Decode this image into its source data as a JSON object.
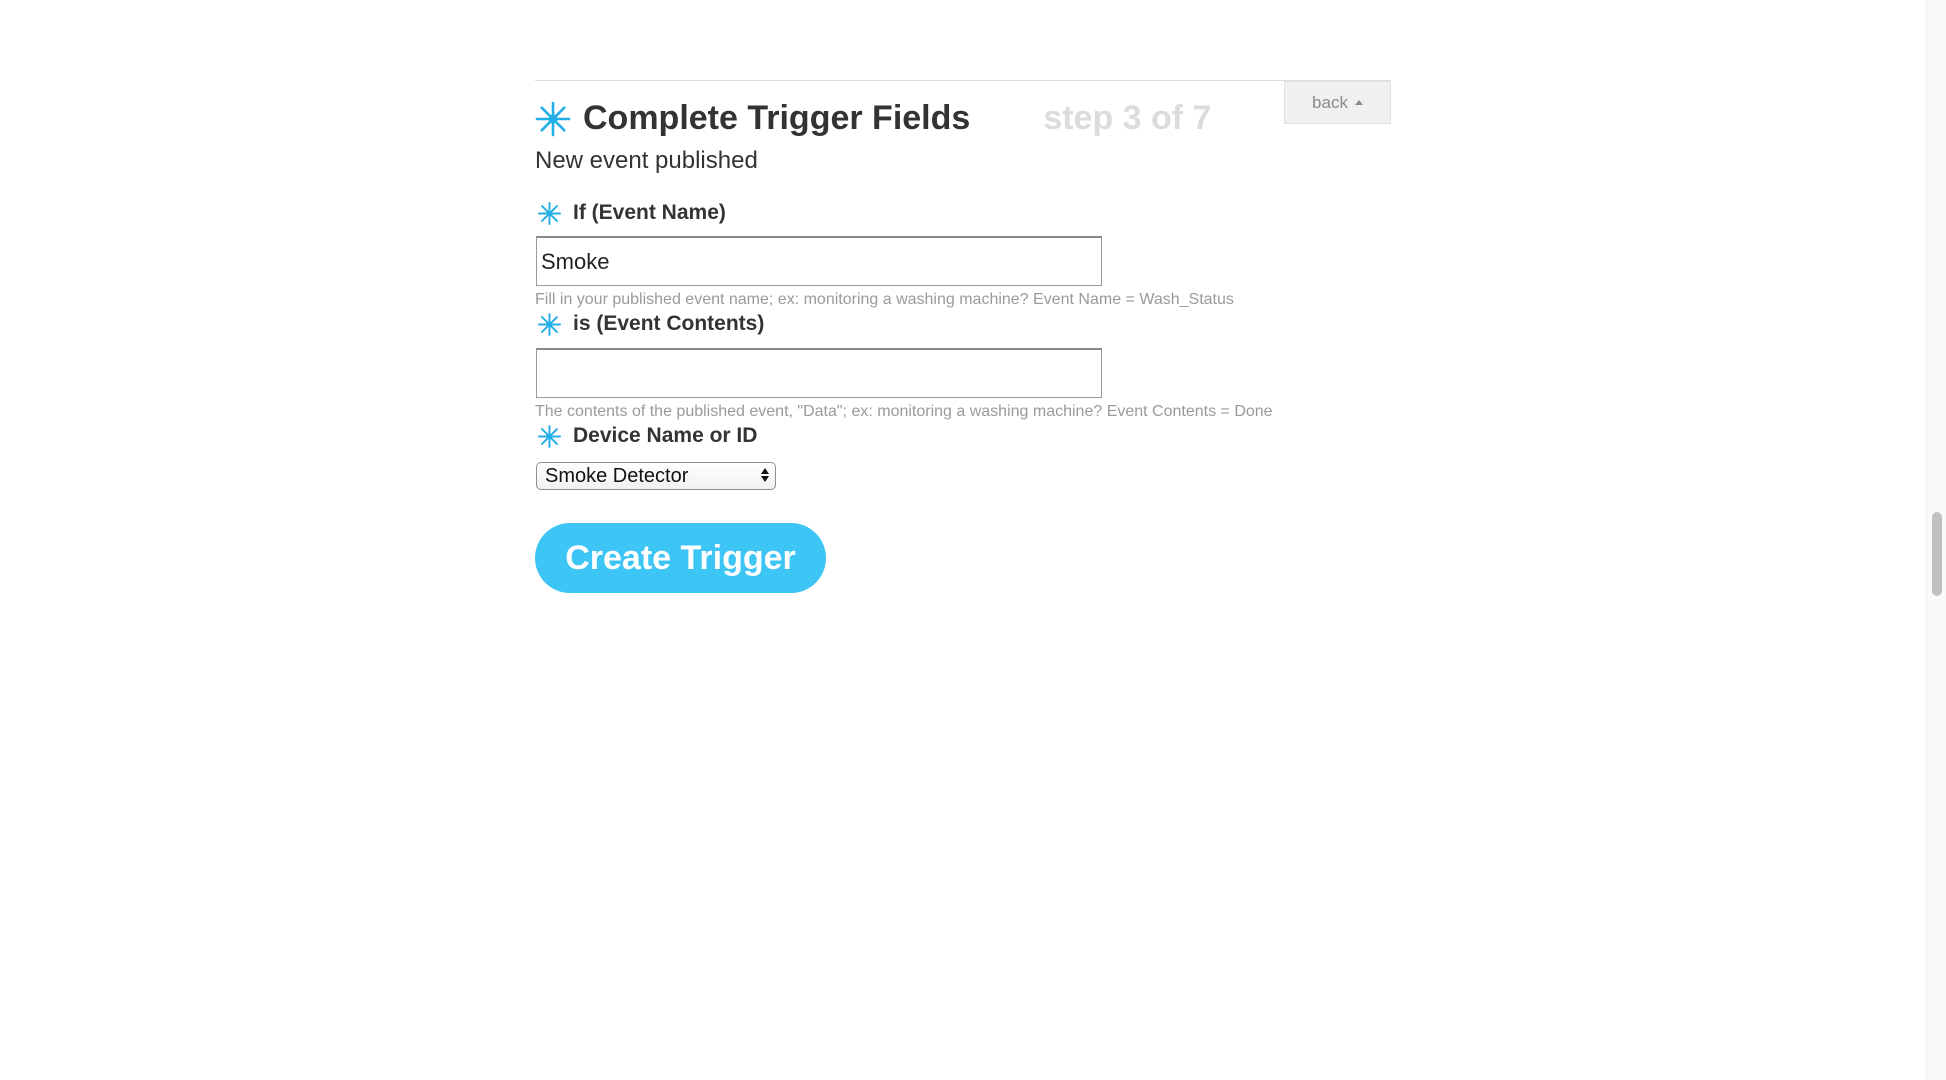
{
  "header": {
    "title": "Complete Trigger Fields",
    "step": "step 3 of 7",
    "back_label": "back",
    "subtitle": "New event published"
  },
  "fields": [
    {
      "label": "If (Event Name)",
      "value": "Smoke",
      "placeholder": "",
      "help": "Fill in your published event name; ex: monitoring a washing machine? Event Name = Wash_Status"
    },
    {
      "label": "is (Event Contents)",
      "value": "",
      "placeholder": "",
      "help": "The contents of the published event, \"Data\"; ex: monitoring a washing machine? Event Contents = Done"
    },
    {
      "label": "Device Name or ID",
      "selected": "Smoke Detector"
    }
  ],
  "create_button": {
    "label": "Create Trigger"
  },
  "colors": {
    "accent": "#3dc5f5",
    "step_text": "#dcdcdc",
    "help_text": "#9a9a9a"
  },
  "icons": {
    "required": "asterisk-star-icon",
    "back_caret": "caret-up-icon",
    "select_arrows": "select-arrows-icon"
  }
}
